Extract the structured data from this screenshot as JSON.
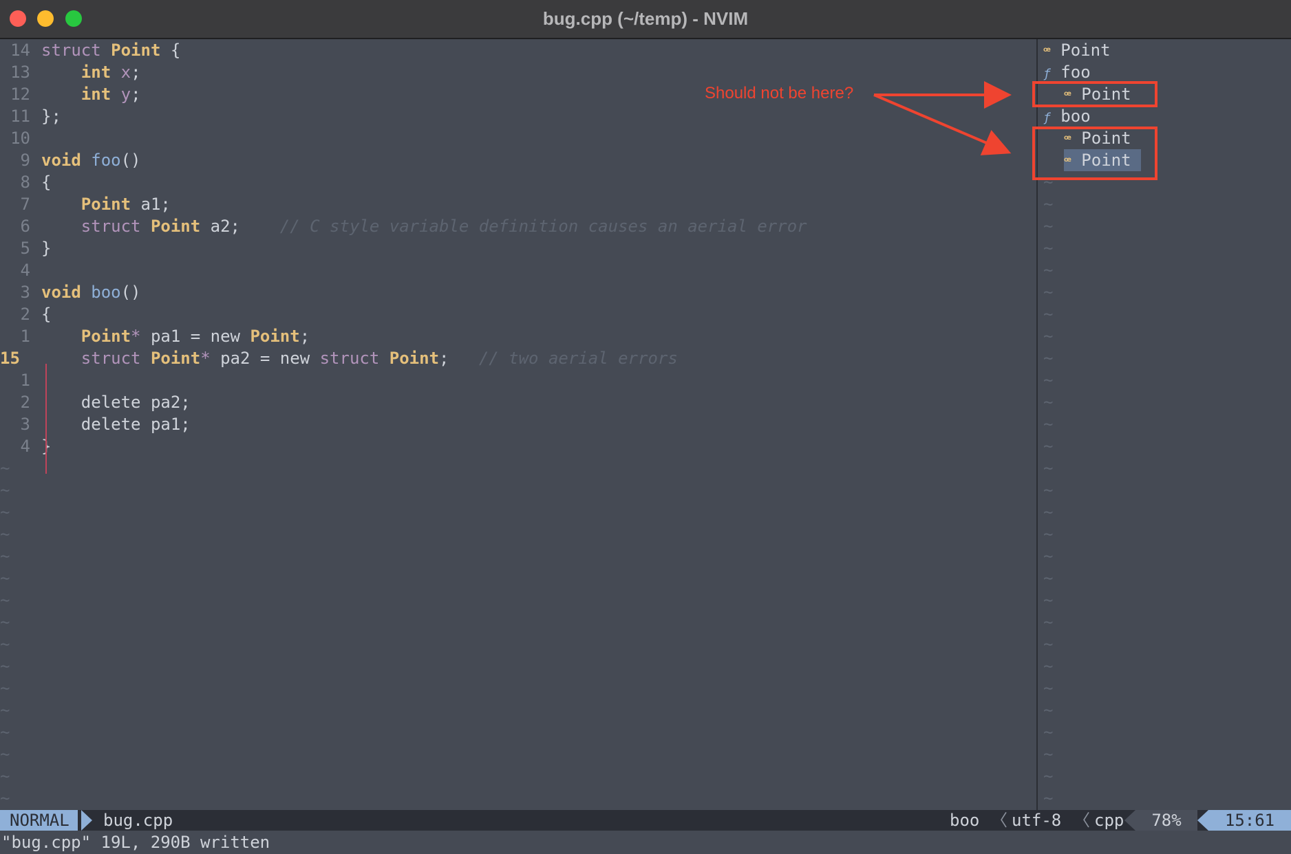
{
  "window": {
    "title": "bug.cpp (~/temp) - NVIM"
  },
  "editor": {
    "lines": [
      {
        "ln": "14",
        "segs": [
          {
            "c": "kw",
            "t": "struct"
          },
          {
            "c": "",
            "t": " "
          },
          {
            "c": "ty",
            "t": "Point"
          },
          {
            "c": "",
            "t": " {"
          }
        ]
      },
      {
        "ln": "13",
        "segs": [
          {
            "c": "",
            "t": "    "
          },
          {
            "c": "ty",
            "t": "int"
          },
          {
            "c": "",
            "t": " "
          },
          {
            "c": "kw",
            "t": "x"
          },
          {
            "c": "",
            "t": ";"
          }
        ]
      },
      {
        "ln": "12",
        "segs": [
          {
            "c": "",
            "t": "    "
          },
          {
            "c": "ty",
            "t": "int"
          },
          {
            "c": "",
            "t": " "
          },
          {
            "c": "kw",
            "t": "y"
          },
          {
            "c": "",
            "t": ";"
          }
        ]
      },
      {
        "ln": "11",
        "segs": [
          {
            "c": "",
            "t": "};"
          }
        ]
      },
      {
        "ln": "10",
        "segs": []
      },
      {
        "ln": "9",
        "segs": [
          {
            "c": "ty",
            "t": "void"
          },
          {
            "c": "",
            "t": " "
          },
          {
            "c": "fn",
            "t": "foo"
          },
          {
            "c": "",
            "t": "()"
          }
        ]
      },
      {
        "ln": "8",
        "segs": [
          {
            "c": "",
            "t": "{"
          }
        ]
      },
      {
        "ln": "7",
        "segs": [
          {
            "c": "",
            "t": "    "
          },
          {
            "c": "ty",
            "t": "Point"
          },
          {
            "c": "",
            "t": " a1;"
          }
        ]
      },
      {
        "ln": "6",
        "segs": [
          {
            "c": "",
            "t": "    "
          },
          {
            "c": "kw",
            "t": "struct"
          },
          {
            "c": "",
            "t": " "
          },
          {
            "c": "ty",
            "t": "Point"
          },
          {
            "c": "",
            "t": " a2;    "
          },
          {
            "c": "cm",
            "t": "// C style variable definition causes an aerial error"
          }
        ]
      },
      {
        "ln": "5",
        "segs": [
          {
            "c": "",
            "t": "}"
          }
        ]
      },
      {
        "ln": "4",
        "segs": []
      },
      {
        "ln": "3",
        "segs": [
          {
            "c": "ty",
            "t": "void"
          },
          {
            "c": "",
            "t": " "
          },
          {
            "c": "fn",
            "t": "boo"
          },
          {
            "c": "",
            "t": "()"
          }
        ]
      },
      {
        "ln": "2",
        "segs": [
          {
            "c": "",
            "t": "{"
          }
        ]
      },
      {
        "ln": "1",
        "segs": [
          {
            "c": "",
            "t": "    "
          },
          {
            "c": "ty",
            "t": "Point"
          },
          {
            "c": "kw",
            "t": "*"
          },
          {
            "c": "",
            "t": " pa1 = new "
          },
          {
            "c": "ty",
            "t": "Point"
          },
          {
            "c": "",
            "t": ";"
          }
        ]
      },
      {
        "ln": "15",
        "cur": true,
        "segs": [
          {
            "c": "",
            "t": "    "
          },
          {
            "c": "kw",
            "t": "struct"
          },
          {
            "c": "",
            "t": " "
          },
          {
            "c": "ty",
            "t": "Point"
          },
          {
            "c": "kw",
            "t": "*"
          },
          {
            "c": "",
            "t": " pa2 = new "
          },
          {
            "c": "kw",
            "t": "struct"
          },
          {
            "c": "",
            "t": " "
          },
          {
            "c": "ty",
            "t": "Point"
          },
          {
            "c": "",
            "t": ";   "
          },
          {
            "c": "cm",
            "t": "// two aerial errors"
          }
        ]
      },
      {
        "ln": "1",
        "segs": []
      },
      {
        "ln": "2",
        "segs": [
          {
            "c": "",
            "t": "    delete pa2;"
          }
        ]
      },
      {
        "ln": "3",
        "segs": [
          {
            "c": "",
            "t": "    delete pa1;"
          }
        ]
      },
      {
        "ln": "4",
        "segs": [
          {
            "c": "",
            "t": "}"
          }
        ]
      }
    ],
    "tilde": "~"
  },
  "outline": {
    "items": [
      {
        "icon": "ꟹ",
        "kind": "struct",
        "label": "Point",
        "indent": 0
      },
      {
        "icon": "ƒ",
        "kind": "function",
        "label": "foo",
        "indent": 0
      },
      {
        "icon": "ꟹ",
        "kind": "struct",
        "label": "Point",
        "indent": 1
      },
      {
        "icon": "ƒ",
        "kind": "function",
        "label": "boo",
        "indent": 0
      },
      {
        "icon": "ꟹ",
        "kind": "struct",
        "label": "Point",
        "indent": 1
      },
      {
        "icon": "ꟹ",
        "kind": "struct",
        "label": "Point",
        "indent": 1,
        "selected": true
      }
    ]
  },
  "annotation": {
    "text": "Should not be here?",
    "color": "#ef4430"
  },
  "statusline": {
    "mode": "NORMAL",
    "filename": "bug.cpp",
    "symbol": "boo",
    "encoding": "utf-8",
    "filetype": "cpp",
    "percent": "78%",
    "position": "15:61"
  },
  "cmdline": {
    "message": "\"bug.cpp\" 19L, 290B written"
  }
}
